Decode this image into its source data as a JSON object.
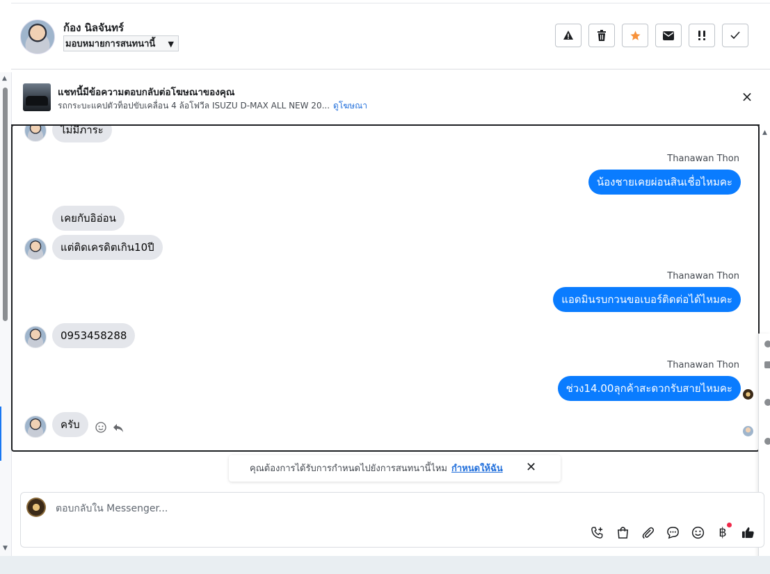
{
  "header": {
    "contact_name": "ก้อง นิลจันทร์",
    "assign_value": "มอบหมายการสนทนานี้"
  },
  "ad": {
    "title": "แชทนี้มีข้อความตอบกลับต่อโฆษณาของคุณ",
    "description": "รถกระบะแคปตัวท็อปขับเคลื่อน 4 ล้อโฟวีล ISUZU D-MAX ALL NEW 20...",
    "link_label": "ดูโฆษณา"
  },
  "messages": [
    {
      "dir": "in",
      "text": "ไม่มีภาระ"
    },
    {
      "dir": "out",
      "sender": "Thanawan Thon",
      "text": "น้องชายเคยผ่อนสินเชื่อไหมคะ"
    },
    {
      "dir": "in",
      "text": "เคยกับอิอ่อน"
    },
    {
      "dir": "in",
      "text": "แต่ติดเครดิตเกิน10ปี"
    },
    {
      "dir": "out",
      "sender": "Thanawan Thon",
      "text": "แอดมินรบกวนขอเบอร์ติดต่อได้ไหมคะ"
    },
    {
      "dir": "in",
      "text": "0953458288"
    },
    {
      "dir": "out",
      "sender": "Thanawan Thon",
      "text": "ช่วง14.00ลุกค้าสะดวกรับสายไหมคะ"
    },
    {
      "dir": "in",
      "text": "ครับ"
    }
  ],
  "assign_prompt": {
    "text": "คุณต้องการได้รับการกำหนดไปยังการสนทนานี้ไหม",
    "link_label": "กำหนดให้ฉัน"
  },
  "composer": {
    "placeholder": "ตอบกลับใน Messenger..."
  },
  "icons": {
    "header_actions": [
      "alert-icon",
      "trash-icon",
      "star-icon",
      "mail-icon",
      "priority-icon",
      "check-icon"
    ],
    "composer_tools": [
      "add-call-icon",
      "shopping-bag-icon",
      "attachment-icon",
      "saved-reply-icon",
      "emoji-icon",
      "baht-icon",
      "thumbs-up-icon"
    ]
  },
  "colors": {
    "outgoing_bubble": "#0a7cff",
    "incoming_bubble": "#e4e6eb",
    "star": "#f7923b",
    "link": "#216fdb"
  }
}
